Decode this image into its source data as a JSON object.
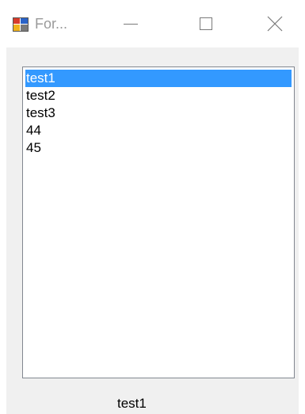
{
  "window": {
    "title": "For...",
    "app_icon": "winforms-app-icon",
    "controls": {
      "minimize_icon": "minimize-icon",
      "maximize_icon": "maximize-icon",
      "close_icon": "close-icon"
    }
  },
  "listbox": {
    "items": [
      "test1",
      "test2",
      "test3",
      "44",
      "45"
    ],
    "selected_index": 0,
    "selection_color": "#3399ff"
  },
  "status": {
    "label": "test1"
  }
}
